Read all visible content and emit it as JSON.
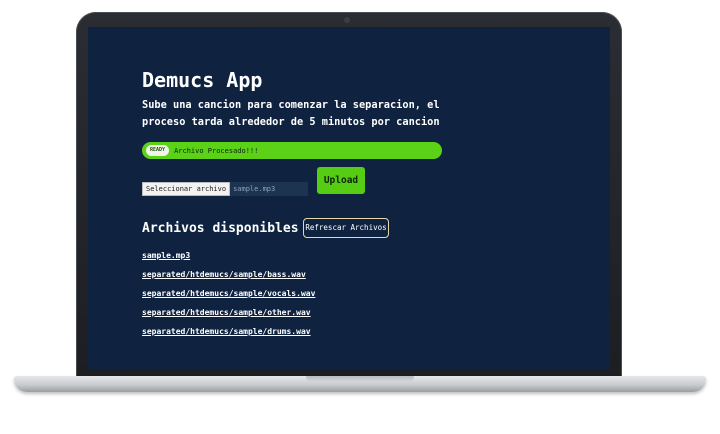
{
  "app": {
    "title": "Demucs App",
    "description": "Sube una cancion para comenzar la separacion, el proceso tarda alrededor de 5 minutos por cancion"
  },
  "status": {
    "badge": "READY",
    "message": "Archivo Procesado!!!",
    "color": "#5bd117"
  },
  "upload": {
    "select_label": "Seleccionar archivo",
    "selected_file": "sample.mp3",
    "button_label": "Upload"
  },
  "files": {
    "heading": "Archivos disponibles",
    "refresh_label": "Refrescar Archivos",
    "items": [
      "sample.mp3",
      "separated/htdemucs/sample/bass.wav",
      "separated/htdemucs/sample/vocals.wav",
      "separated/htdemucs/sample/other.wav",
      "separated/htdemucs/sample/drums.wav"
    ]
  },
  "colors": {
    "background": "#0f2341",
    "accent": "#56cc14",
    "text": "#ffffff"
  }
}
